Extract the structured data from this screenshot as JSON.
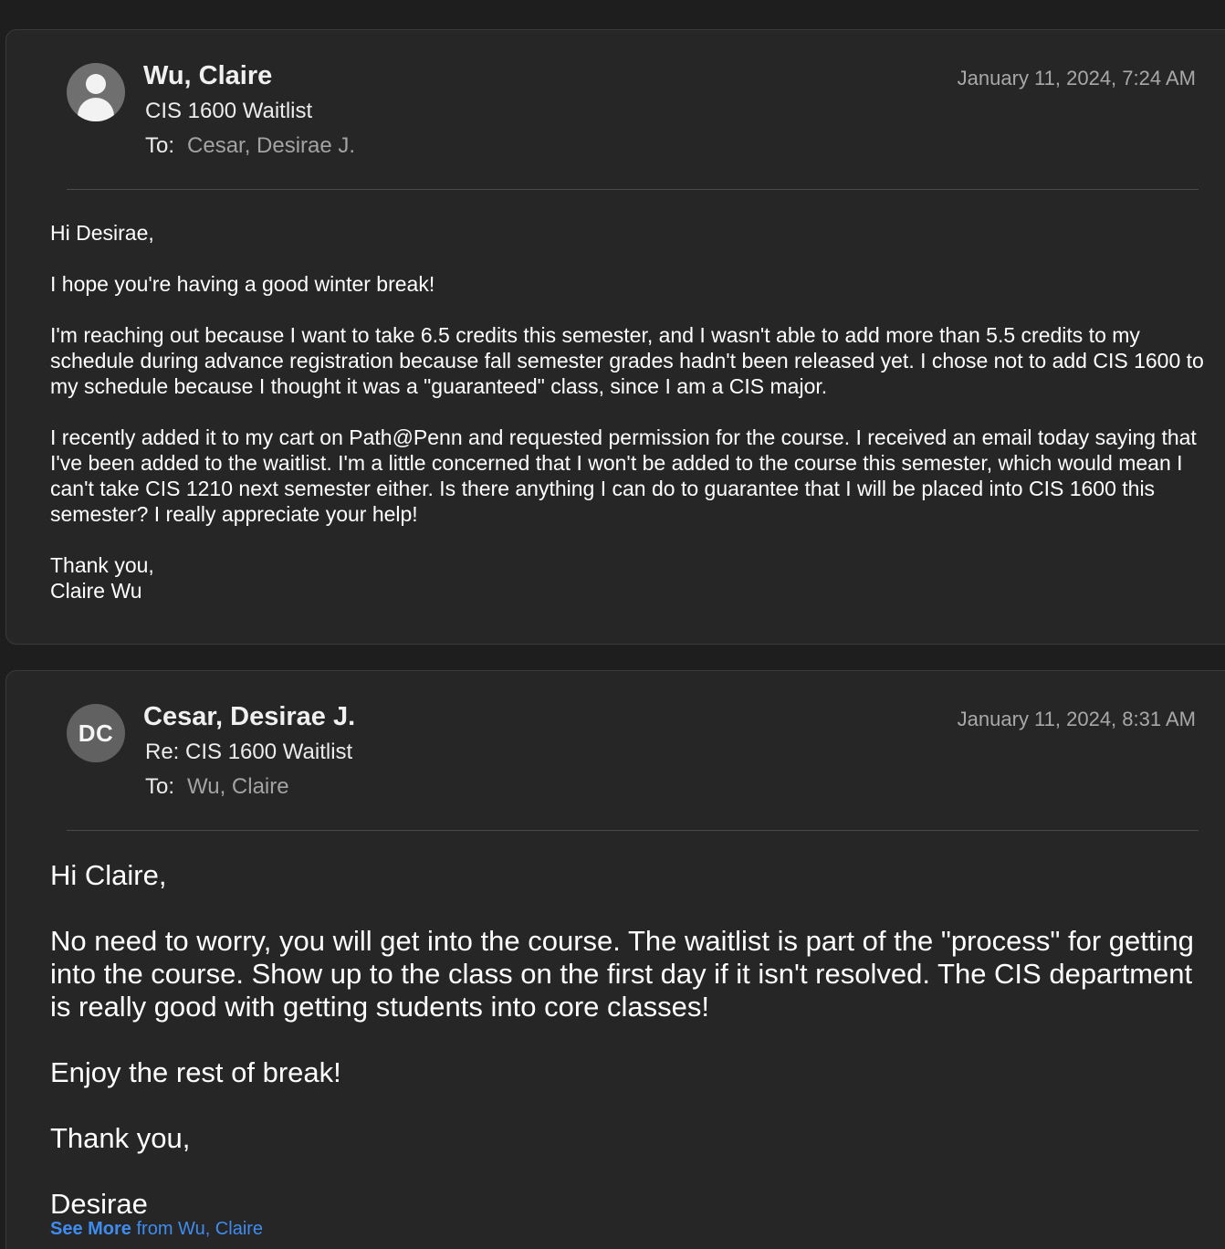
{
  "messages": [
    {
      "sender": "Wu, Claire",
      "subject": "CIS 1600 Waitlist",
      "to_label": "To:",
      "to": "Cesar, Desirae J.",
      "date": "January 11, 2024, 7:24 AM",
      "avatar_icon": "person-silhouette-icon",
      "greeting": "Hi Desirae,",
      "paragraphs": [
        "I hope you're having a good winter break!",
        "I'm reaching out because I want to take 6.5 credits this semester, and I wasn't able to add more than 5.5 credits to my schedule during advance registration because fall semester grades hadn't been released yet. I chose not to add CIS 1600 to my schedule because I thought it was a \"guaranteed\" class, since I am a CIS major.",
        "I recently added it to my cart on Path@Penn and requested permission for the course. I received an email today saying that I've been added to the waitlist. I'm a little concerned that I won't be added to the course this semester, which would mean I can't take CIS 1210 next semester either. Is there anything I can do to guarantee that I will be placed into CIS 1600 this semester? I really appreciate your help!"
      ],
      "closing": "Thank you,",
      "signature": "Claire Wu"
    },
    {
      "sender": "Cesar, Desirae J.",
      "subject": "Re: CIS 1600 Waitlist",
      "to_label": "To:",
      "to": "Wu, Claire",
      "date": "January 11, 2024, 8:31 AM",
      "avatar_initials": "DC",
      "greeting": "Hi Claire,",
      "paragraphs": [
        "No need to worry, you will get into the course. The waitlist is part of the \"process\" for getting into the course. Show up to the class on the first day if it isn't resolved. The CIS department is really good with getting students into core classes!",
        "Enjoy the rest of break!"
      ],
      "closing": "Thank you,",
      "signature": "Desirae",
      "see_more_label": "See More",
      "see_more_from": "from Wu, Claire"
    }
  ],
  "colors": {
    "background": "#1e1e1e",
    "card": "#262626",
    "link": "#3f8cf0",
    "muted": "#a8a8a8"
  }
}
